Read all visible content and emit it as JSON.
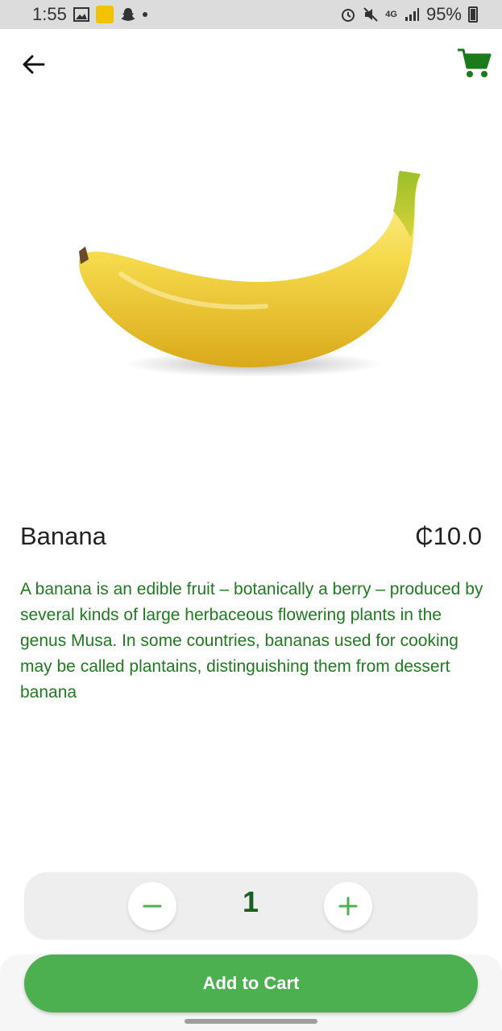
{
  "status_bar": {
    "time": "1:55",
    "battery": "95%",
    "network": "4G"
  },
  "app_bar": {
    "back_icon": "arrow-left-icon",
    "cart_icon": "shopping-cart-icon"
  },
  "product": {
    "name": "Banana",
    "price": "₵10.0",
    "description": "A banana is an edible fruit – botanically a berry – produced by several kinds of large herbaceous flowering plants in the genus Musa. In some countries, bananas used for cooking may be called plantains, distinguishing them from dessert banana",
    "image_icon": "banana-image"
  },
  "quantity": {
    "value": "1",
    "decrement_icon": "minus-icon",
    "increment_icon": "plus-icon"
  },
  "actions": {
    "add_to_cart_label": "Add to Cart"
  },
  "colors": {
    "accent": "#4caf50",
    "dark_green": "#1b5e20",
    "description_text": "#1f7a1f"
  }
}
